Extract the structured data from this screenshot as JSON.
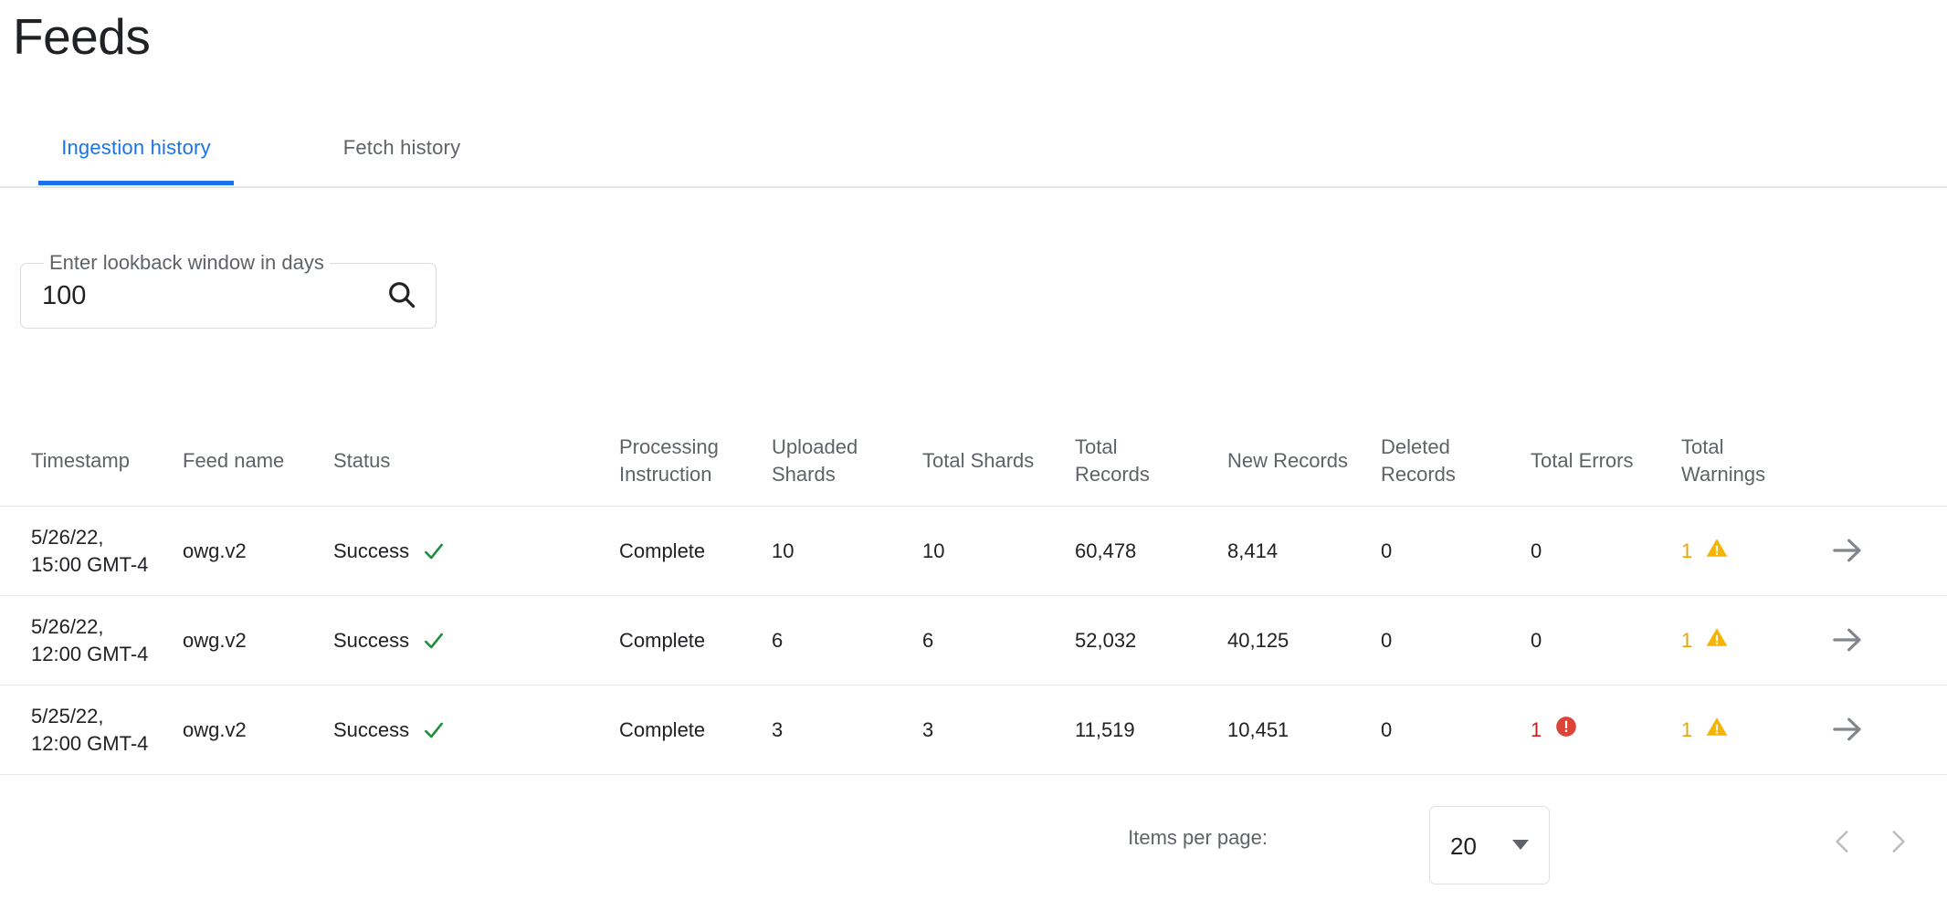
{
  "page": {
    "title": "Feeds"
  },
  "tabs": [
    {
      "label": "Ingestion history",
      "active": true
    },
    {
      "label": "Fetch history",
      "active": false
    }
  ],
  "lookback": {
    "label": "Enter lookback window in days",
    "value": "100",
    "placeholder": "",
    "search_icon": "search-icon"
  },
  "table": {
    "columns": [
      "Timestamp",
      "Feed name",
      "Status",
      "Processing Instruction",
      "Uploaded Shards",
      "Total Shards",
      "Total Records",
      "New Records",
      "Deleted Records",
      "Total Errors",
      "Total Warnings"
    ],
    "rows": [
      {
        "timestamp_line1": "5/26/22,",
        "timestamp_line2": "15:00 GMT-4",
        "feed_name": "owg.v2",
        "status": "Success",
        "status_icon": "check-icon",
        "processing_instruction": "Complete",
        "uploaded_shards": "10",
        "total_shards": "10",
        "total_records": "60,478",
        "new_records": "8,414",
        "deleted_records": "0",
        "total_errors": "0",
        "total_errors_icon": false,
        "total_warnings": "1",
        "total_warnings_icon": true,
        "action_icon": "arrow-right-icon"
      },
      {
        "timestamp_line1": "5/26/22,",
        "timestamp_line2": "12:00 GMT-4",
        "feed_name": "owg.v2",
        "status": "Success",
        "status_icon": "check-icon",
        "processing_instruction": "Complete",
        "uploaded_shards": "6",
        "total_shards": "6",
        "total_records": "52,032",
        "new_records": "40,125",
        "deleted_records": "0",
        "total_errors": "0",
        "total_errors_icon": false,
        "total_warnings": "1",
        "total_warnings_icon": true,
        "action_icon": "arrow-right-icon"
      },
      {
        "timestamp_line1": "5/25/22,",
        "timestamp_line2": "12:00 GMT-4",
        "feed_name": "owg.v2",
        "status": "Success",
        "status_icon": "check-icon",
        "processing_instruction": "Complete",
        "uploaded_shards": "3",
        "total_shards": "3",
        "total_records": "11,519",
        "new_records": "10,451",
        "deleted_records": "0",
        "total_errors": "1",
        "total_errors_icon": true,
        "total_warnings": "1",
        "total_warnings_icon": true,
        "action_icon": "arrow-right-icon"
      }
    ]
  },
  "paginator": {
    "items_per_page_label": "Items per page:",
    "items_per_page_value": "20",
    "prev_icon": "chevron-left-icon",
    "next_icon": "chevron-right-icon"
  },
  "colors": {
    "accent_blue": "#1a73e8",
    "success_green": "#1e8e3e",
    "error_red": "#db4437",
    "warning_amber": "#f4b400",
    "text_primary": "#202124",
    "text_secondary": "#5f6368"
  }
}
